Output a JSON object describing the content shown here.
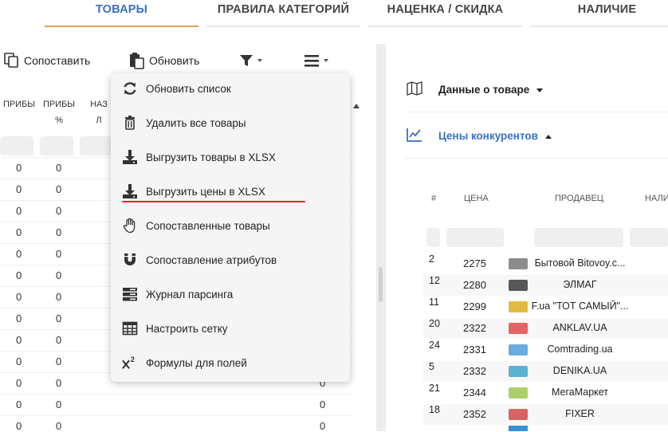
{
  "tabs": [
    {
      "label": "ТОВАРЫ",
      "active": true
    },
    {
      "label": "ПРАВИЛА КАТЕГОРИЙ",
      "active": false
    },
    {
      "label": "НАЦЕНКА / СКИДКА",
      "active": false
    },
    {
      "label": "НАЛИЧИЕ",
      "active": false
    }
  ],
  "toolbar": {
    "compare_label": "Сопоставить",
    "update_label": "Обновить"
  },
  "grid": {
    "headers": [
      "ПРИБЫ",
      "ПРИБЫ\n%",
      "НАЗ\nЛ"
    ],
    "zero_value": "0"
  },
  "menu": {
    "items": [
      {
        "label": "Обновить список",
        "icon": "refresh-icon"
      },
      {
        "label": "Удалить все товары",
        "icon": "trash-icon"
      },
      {
        "label": "Выгрузить товары в XLSX",
        "icon": "download-icon"
      },
      {
        "label": "Выгрузить цены в XLSX",
        "icon": "download-icon"
      },
      {
        "label": "Сопоставленные товары",
        "icon": "hand-icon"
      },
      {
        "label": "Сопоставление атрибутов",
        "icon": "magnet-icon"
      },
      {
        "label": "Журнал парсинга",
        "icon": "server-icon"
      },
      {
        "label": "Настроить сетку",
        "icon": "table-icon"
      },
      {
        "label": "Формулы для полей",
        "icon": "superscript-icon"
      }
    ]
  },
  "right": {
    "product_data_label": "Данные о товаре",
    "competitor_prices_label": "Цены конкурентов",
    "table_headers": {
      "num": "#",
      "price": "ЦЕНА",
      "seller": "ПРОДАВЕЦ",
      "avail": "НАЛИ"
    },
    "rows": [
      {
        "num": "2",
        "price": "2275",
        "seller": "Бытовой Bitovoy.c..."
      },
      {
        "num": "12",
        "price": "2280",
        "seller": "ЭЛМАГ"
      },
      {
        "num": "11",
        "price": "2299",
        "seller": "F.ua \"ТОТ САМЫЙ\"..."
      },
      {
        "num": "20",
        "price": "2322",
        "seller": "ANKLAV.UA"
      },
      {
        "num": "24",
        "price": "2331",
        "seller": "Comtrading.ua"
      },
      {
        "num": "5",
        "price": "2332",
        "seller": "DENIKA.UA"
      },
      {
        "num": "21",
        "price": "2344",
        "seller": "МегаМаркет"
      },
      {
        "num": "18",
        "price": "2352",
        "seller": "FIXER"
      }
    ]
  },
  "colors": {
    "accent": "#3a6fc1",
    "tab_underline": "#e0a35a",
    "highlight": "#e8232a"
  }
}
